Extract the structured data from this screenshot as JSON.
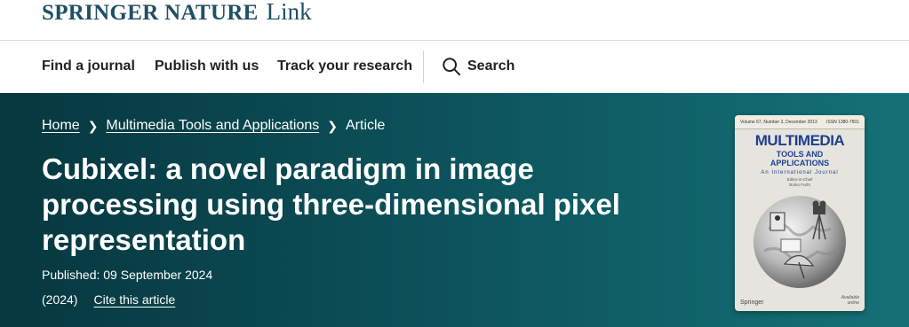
{
  "header": {
    "brand_main": "SPRINGER NATURE",
    "brand_link": "Link"
  },
  "nav": {
    "find_journal": "Find a journal",
    "publish": "Publish with us",
    "track": "Track your research",
    "search": "Search"
  },
  "breadcrumb": {
    "home": "Home",
    "journal": "Multimedia Tools and Applications",
    "current": "Article"
  },
  "article": {
    "title": "Cubixel: a novel paradigm in image processing using three-dimensional pixel representation",
    "published": "Published: 09 September 2024",
    "year": "(2024)",
    "cite": "Cite this article"
  },
  "cover": {
    "issue": "Volume 67, Number 3, December 2013",
    "issn": "ISSN 1380-7501",
    "title": "MULTIMEDIA",
    "subtitle_line1": "TOOLS AND",
    "subtitle_line2": "APPLICATIONS",
    "journal_label": "An International Journal",
    "editors_line1": "Editor-in-Chief",
    "editors_line2": "Borko Furht",
    "publisher": "Springer",
    "online_line1": "Available",
    "online_line2": "online"
  },
  "icons": {
    "search": "search-icon",
    "chevron": "chevron-right-icon"
  },
  "colors": {
    "brand": "#1f4f63",
    "hero_start": "#07373f",
    "hero_end": "#157177"
  }
}
